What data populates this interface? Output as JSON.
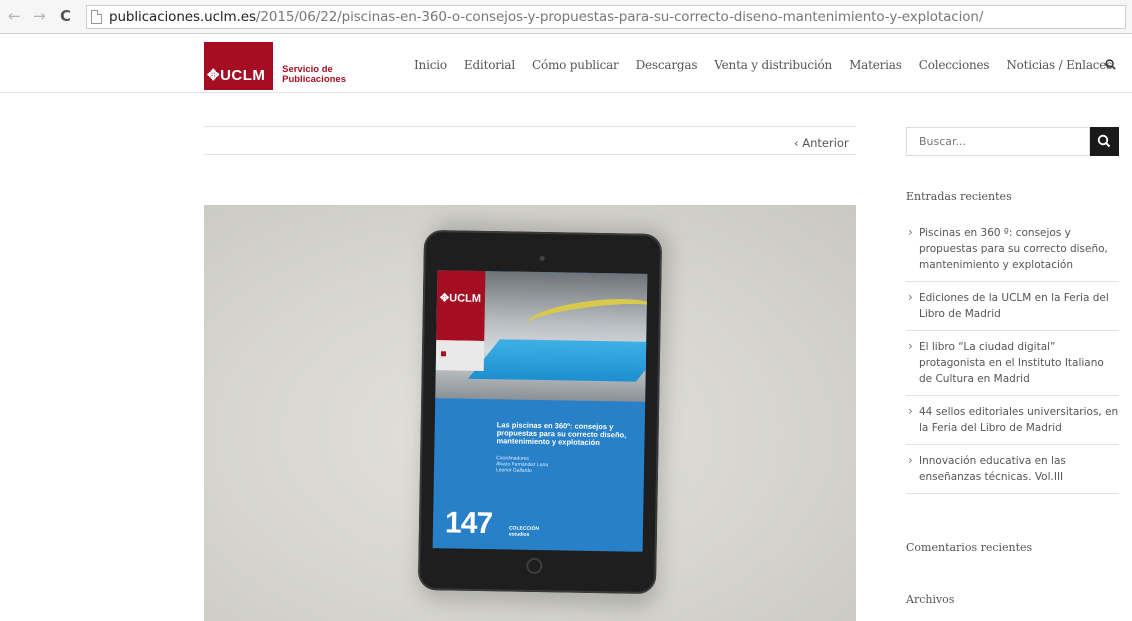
{
  "browser": {
    "url_host": "publicaciones.uclm.es",
    "url_path": "/2015/06/22/piscinas-en-360-o-consejos-y-propuestas-para-su-correcto-diseno-mantenimiento-y-explotacion/",
    "back_icon": "←",
    "forward_icon": "→",
    "reload_icon": "C"
  },
  "header": {
    "logo_brand": "✥UCLM",
    "logo_line1": "Servicio de",
    "logo_line2": "Publicaciones",
    "nav": [
      "Inicio",
      "Editorial",
      "Cómo publicar",
      "Descargas",
      "Venta y distribución",
      "Materias",
      "Colecciones",
      "Noticias / Enlaces"
    ]
  },
  "post": {
    "prev_link": "‹ Anterior",
    "cover": {
      "brand": "✥UCLM",
      "title": "Las piscinas en 360º: consejos y propuestas para su correcto diseño, mantenimiento y explotación",
      "coordinators_label": "Coordinadores",
      "coordinators": "Álvaro Fernández Luna\nLeonor Gallardo",
      "number": "147",
      "collection": "COLECCIÓN\nestudios"
    }
  },
  "sidebar": {
    "search_placeholder": "Buscar...",
    "recent_title": "Entradas recientes",
    "recent": [
      "Piscinas en 360 º: consejos y propuestas para su correcto diseño, mantenimiento y explotación",
      "Ediciones de la UCLM en la Feria del Libro de Madrid",
      "El libro “La ciudad digital” protagonista en el Instituto Italiano de Cultura en Madrid",
      "44 sellos editoriales universitarios, en la Feria del Libro de Madrid",
      "Innovación educativa en las enseñanzas técnicas. Vol.III"
    ],
    "comments_title": "Comentarios recientes",
    "archives_title": "Archivos"
  },
  "colors": {
    "brand_red": "#a50e22",
    "cover_blue": "#2780c8",
    "search_button": "#1a1a1a"
  }
}
